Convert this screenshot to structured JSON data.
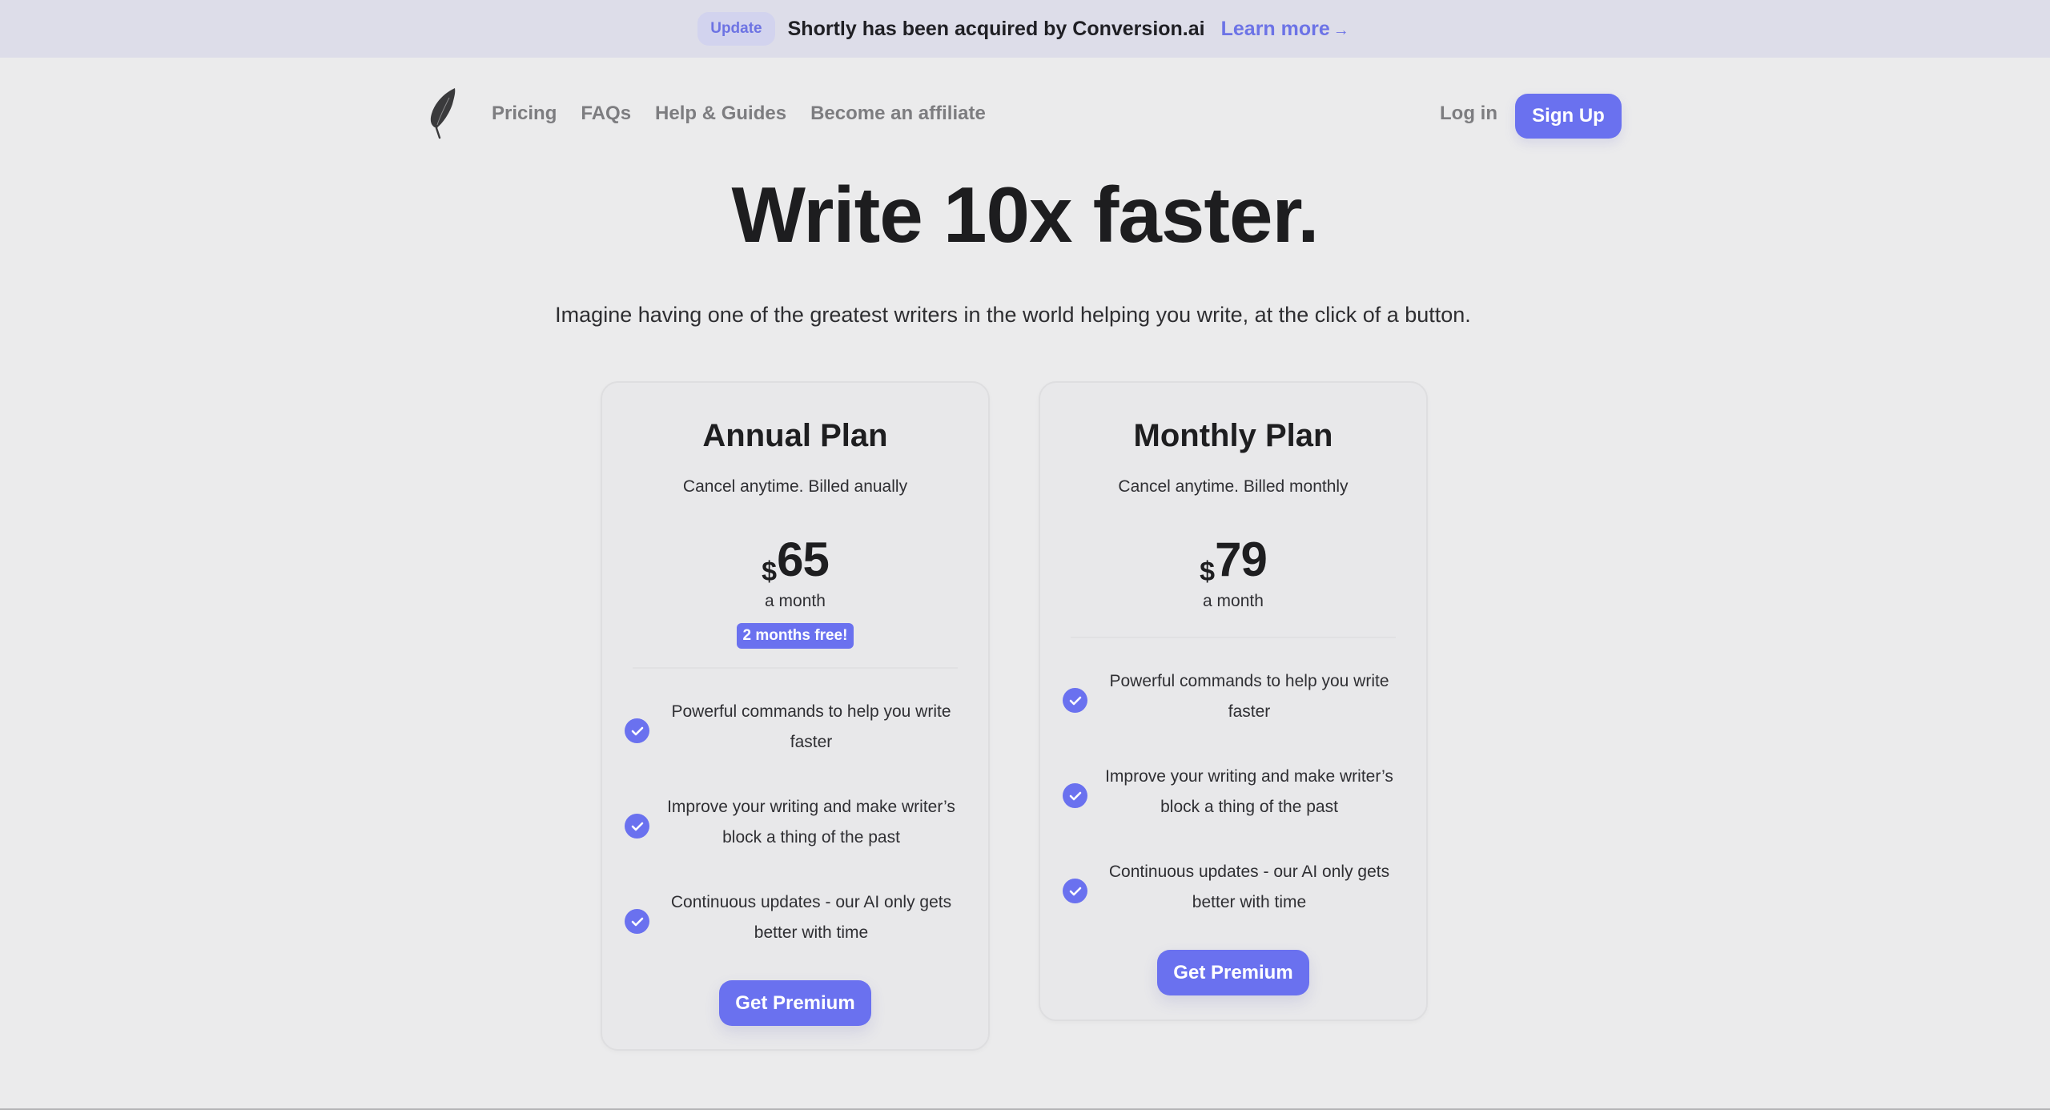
{
  "banner": {
    "badge": "Update",
    "text": "Shortly has been acquired by Conversion.ai",
    "link_label": "Learn more",
    "link_arrow": "→"
  },
  "nav": {
    "logo_icon": "feather-icon",
    "links": [
      {
        "label": "Pricing"
      },
      {
        "label": "FAQs"
      },
      {
        "label": "Help & Guides"
      },
      {
        "label": "Become an affiliate"
      }
    ],
    "login_label": "Log in",
    "signup_label": "Sign Up"
  },
  "hero": {
    "title": "Write 10x faster.",
    "subtitle": "Imagine having one of the greatest writers in the world helping you write, at the click of a button."
  },
  "plans": [
    {
      "name": "Annual Plan",
      "billing": "Cancel anytime. Billed anually",
      "currency": "$",
      "price": "65",
      "period": "a month",
      "promo": "2 months free!",
      "features": [
        "Powerful commands to help you write faster",
        "Improve your writing and make writer’s block a thing of the past",
        "Continuous updates - our AI only gets better with time"
      ],
      "cta": "Get Premium"
    },
    {
      "name": "Monthly Plan",
      "billing": "Cancel anytime. Billed monthly",
      "currency": "$",
      "price": "79",
      "period": "a month",
      "features": [
        "Powerful commands to help you write faster",
        "Improve your writing and make writer’s block a thing of the past",
        "Continuous updates - our AI only gets better with time"
      ],
      "cta": "Get Premium"
    }
  ],
  "colors": {
    "accent": "#6a71ef",
    "banner_bg": "#dddde9",
    "page_bg": "#ebebec",
    "card_bg": "#e8e8ea",
    "nav_text": "#7d7d80"
  }
}
